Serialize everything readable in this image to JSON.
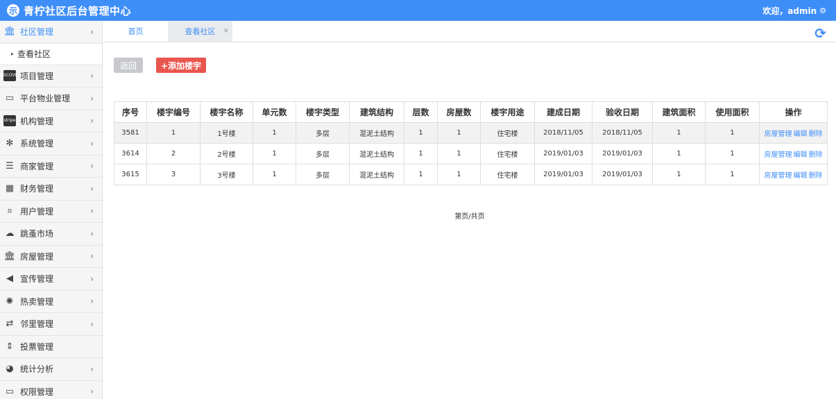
{
  "header": {
    "logo_glyph": "示",
    "title": "青柠社区后台管理中心",
    "welcome": "欢迎，admin"
  },
  "sidebar": {
    "items": [
      {
        "name": "sidebar-item-community",
        "icon": "bank-icon",
        "glyph": "🏛",
        "label": "社区管理",
        "active": true,
        "chevron": true
      },
      {
        "name": "sidebar-item-projects",
        "icon": "discover-card-icon",
        "glyph": "DISCOVER",
        "label": "项目管理",
        "chevron": true
      },
      {
        "name": "sidebar-item-property",
        "icon": "monitor-icon",
        "glyph": "▭",
        "label": "平台物业管理",
        "chevron": true
      },
      {
        "name": "sidebar-item-org",
        "icon": "stripe-icon",
        "glyph": "stripe",
        "label": "机构管理",
        "chevron": true
      },
      {
        "name": "sidebar-item-system",
        "icon": "yelp-icon",
        "glyph": "✻",
        "label": "系统管理",
        "chevron": true
      },
      {
        "name": "sidebar-item-merchant",
        "icon": "bars-icon",
        "glyph": "☰",
        "label": "商家管理",
        "chevron": true
      },
      {
        "name": "sidebar-item-finance",
        "icon": "calculator-icon",
        "glyph": "▦",
        "label": "财务管理",
        "chevron": true
      },
      {
        "name": "sidebar-item-users",
        "icon": "crop-icon",
        "glyph": "⌗",
        "label": "用户管理",
        "chevron": true
      },
      {
        "name": "sidebar-item-flea-market",
        "icon": "cloud-icon",
        "glyph": "☁",
        "label": "跳蚤市场",
        "chevron": true
      },
      {
        "name": "sidebar-item-housing",
        "icon": "bank-icon",
        "glyph": "🏛",
        "label": "房屋管理",
        "chevron": true
      },
      {
        "name": "sidebar-item-promotion",
        "icon": "volume-icon",
        "glyph": "◀",
        "label": "宣传管理",
        "chevron": true
      },
      {
        "name": "sidebar-item-hot-sale",
        "icon": "sun-icon",
        "glyph": "✺",
        "label": "热卖管理",
        "chevron": true
      },
      {
        "name": "sidebar-item-neighbor",
        "icon": "retweet-icon",
        "glyph": "⇄",
        "label": "邻里管理",
        "chevron": true
      },
      {
        "name": "sidebar-item-vote",
        "icon": "sort-icon",
        "glyph": "⇕",
        "label": "投票管理",
        "chevron": false
      },
      {
        "name": "sidebar-item-stats",
        "icon": "pie-chart-icon",
        "glyph": "◕",
        "label": "统计分析",
        "chevron": true
      },
      {
        "name": "sidebar-item-permission",
        "icon": "monitor-icon",
        "glyph": "▭",
        "label": "权限管理",
        "chevron": true
      }
    ],
    "sub_item_label": "查看社区"
  },
  "tabs": [
    {
      "label": "首页"
    },
    {
      "label": "查看社区",
      "close": "×"
    }
  ],
  "toolbar": {
    "back_label": "返回",
    "add_label": "+添加楼宇"
  },
  "table": {
    "headers": [
      "序号",
      "楼宇编号",
      "楼宇名称",
      "单元数",
      "楼宇类型",
      "建筑结构",
      "层数",
      "房屋数",
      "楼宇用途",
      "建成日期",
      "验收日期",
      "建筑面积",
      "使用面积",
      "操作"
    ],
    "rows": [
      [
        "3581",
        "1",
        "1号楼",
        "1",
        "多层",
        "混泥土结构",
        "1",
        "1",
        "住宅楼",
        "2018/11/05",
        "2018/11/05",
        "1",
        "1"
      ],
      [
        "3614",
        "2",
        "2号楼",
        "1",
        "多层",
        "混泥土结构",
        "1",
        "1",
        "住宅楼",
        "2019/01/03",
        "2019/01/03",
        "1",
        "1"
      ],
      [
        "3615",
        "3",
        "3号楼",
        "1",
        "多层",
        "混泥土结构",
        "1",
        "1",
        "住宅楼",
        "2019/01/03",
        "2019/01/03",
        "1",
        "1"
      ]
    ],
    "actions": [
      "房屋管理",
      "编辑",
      "删除"
    ]
  },
  "pager": {
    "text": "第页/共页"
  },
  "colors": {
    "header_bg": "#3e8ef7",
    "accent": "#3e8ef7",
    "add_button": "#e9564e",
    "back_button": "#c7c9cc"
  }
}
